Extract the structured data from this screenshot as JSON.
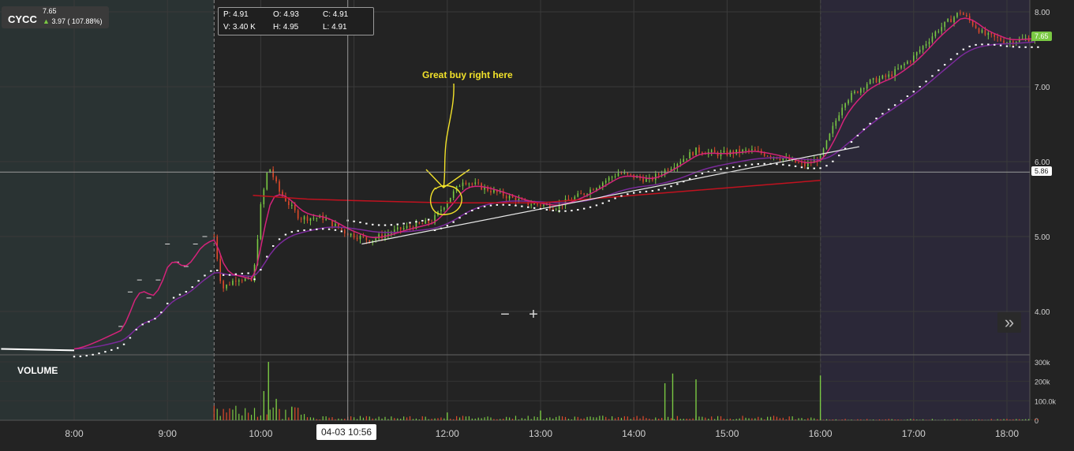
{
  "ticker": {
    "symbol": "CYCC",
    "last_price": "7.65",
    "change": "3.97 ( 107.88%)",
    "arrow_icon": "up-arrow-icon"
  },
  "ohlc_box": {
    "p": "P: 4.91",
    "o": "O: 4.93",
    "c": "C: 4.91",
    "v": "V: 3.40 K",
    "h": "H: 4.95",
    "l": "L: 4.91"
  },
  "annotation": {
    "text": "Great buy right here",
    "color": "#f2e22a"
  },
  "volume_label": "VOLUME",
  "controls": {
    "zoom_out": "−",
    "zoom_in": "+",
    "expand": "»"
  },
  "crosshair": {
    "time_label": "04-03 10:56",
    "price_label": "5.86"
  },
  "last_price_tag": "7.65",
  "colors": {
    "background": "#232323",
    "extended_hours_bg": "#2a3333",
    "after_hours_bg": "#2b2838",
    "up_candle": "#7ac943",
    "down_candle": "#e04a2a",
    "ema_fast": "#d4237a",
    "ema_slow": "#7a2a9a",
    "vwap": "#c1121f",
    "psar": "#ffffff",
    "trendline": "#e8e8e8",
    "annotation": "#f2e22a",
    "last_price_tag": "#7ac943"
  },
  "chart_data": {
    "type": "candlestick",
    "y_axis": {
      "ticks": [
        "8.00",
        "7.00",
        "6.00",
        "5.00",
        "4.00"
      ],
      "range": [
        3.45,
        8.15
      ]
    },
    "volume_axis": {
      "ticks": [
        "300k",
        "200k",
        "100.0k",
        "0"
      ],
      "range": [
        0,
        320000
      ]
    },
    "x_axis": {
      "ticks": [
        "8:00",
        "9:00",
        "10:00",
        "11:00",
        "12:00",
        "13:00",
        "14:00",
        "15:00",
        "16:00",
        "17:00",
        "18:00"
      ],
      "range": [
        "7:13",
        "18:23"
      ]
    },
    "sessions": {
      "premarket_end": "9:30",
      "regular_end": "16:00"
    },
    "price_path": [
      [
        "7:13",
        3.5
      ],
      [
        "8:00",
        3.5
      ],
      [
        "8:30",
        3.8
      ],
      [
        "8:35",
        4.2
      ],
      [
        "8:40",
        4.5
      ],
      [
        "8:50",
        4.1
      ],
      [
        "9:00",
        4.9
      ],
      [
        "9:10",
        4.5
      ],
      [
        "9:20",
        5.0
      ],
      [
        "9:30",
        5.0
      ],
      [
        "9:35",
        4.3
      ],
      [
        "9:45",
        4.45
      ],
      [
        "9:55",
        4.4
      ],
      [
        "10:00",
        5.4
      ],
      [
        "10:05",
        5.95
      ],
      [
        "10:12",
        5.6
      ],
      [
        "10:25",
        5.25
      ],
      [
        "10:40",
        5.25
      ],
      [
        "10:55",
        5.05
      ],
      [
        "11:10",
        4.95
      ],
      [
        "11:30",
        5.1
      ],
      [
        "11:50",
        5.2
      ],
      [
        "12:10",
        5.75
      ],
      [
        "12:30",
        5.6
      ],
      [
        "12:50",
        5.45
      ],
      [
        "13:10",
        5.4
      ],
      [
        "13:30",
        5.6
      ],
      [
        "13:50",
        5.85
      ],
      [
        "14:10",
        5.75
      ],
      [
        "14:25",
        5.95
      ],
      [
        "14:40",
        6.15
      ],
      [
        "14:55",
        6.1
      ],
      [
        "15:15",
        6.15
      ],
      [
        "15:35",
        6.05
      ],
      [
        "15:50",
        5.95
      ],
      [
        "16:00",
        6.05
      ],
      [
        "16:15",
        6.8
      ],
      [
        "16:30",
        7.05
      ],
      [
        "16:45",
        7.15
      ],
      [
        "17:00",
        7.4
      ],
      [
        "17:15",
        7.75
      ],
      [
        "17:30",
        8.0
      ],
      [
        "17:45",
        7.7
      ],
      [
        "18:00",
        7.6
      ],
      [
        "18:15",
        7.65
      ],
      [
        "18:20",
        7.65
      ]
    ],
    "vwap_path": [
      [
        "9:55",
        5.55
      ],
      [
        "10:30",
        5.5
      ],
      [
        "11:00",
        5.48
      ],
      [
        "12:00",
        5.45
      ],
      [
        "13:00",
        5.45
      ],
      [
        "14:00",
        5.55
      ],
      [
        "15:00",
        5.65
      ],
      [
        "16:00",
        5.75
      ]
    ],
    "trendline": [
      [
        "11:05",
        4.9
      ],
      [
        "16:25",
        6.2
      ]
    ],
    "volume_spikes": [
      [
        "10:05",
        300000
      ],
      [
        "10:02",
        150000
      ],
      [
        "10:10",
        110000
      ],
      [
        "10:20",
        70000
      ],
      [
        "12:00",
        40000
      ],
      [
        "14:20",
        190000
      ],
      [
        "14:25",
        240000
      ],
      [
        "14:40",
        210000
      ],
      [
        "13:00",
        50000
      ],
      [
        "16:00",
        230000
      ]
    ],
    "crosshair": {
      "x": "10:56",
      "y": 5.86
    },
    "last_price": 7.65,
    "indicators": [
      "candles",
      "ema_fast",
      "ema_slow",
      "vwap",
      "parabolic_sar",
      "trendline",
      "volume"
    ]
  }
}
